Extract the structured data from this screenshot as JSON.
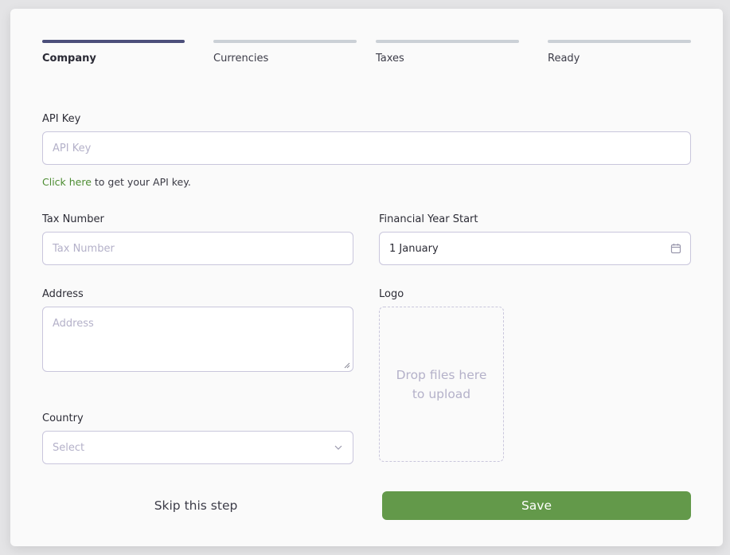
{
  "steps": [
    {
      "label": "Company",
      "active": true
    },
    {
      "label": "Currencies",
      "active": false
    },
    {
      "label": "Taxes",
      "active": false
    },
    {
      "label": "Ready",
      "active": false
    }
  ],
  "form": {
    "api_key": {
      "label": "API Key",
      "placeholder": "API Key"
    },
    "api_helper": {
      "link": "Click here",
      "text": " to get your API key."
    },
    "tax_number": {
      "label": "Tax Number",
      "placeholder": "Tax Number"
    },
    "financial_year": {
      "label": "Financial Year Start",
      "value": "1 January"
    },
    "address": {
      "label": "Address",
      "placeholder": "Address"
    },
    "logo": {
      "label": "Logo",
      "dropzone_text": "Drop files here to upload"
    },
    "country": {
      "label": "Country",
      "placeholder": "Select"
    }
  },
  "actions": {
    "skip_label": "Skip this step",
    "save_label": "Save"
  },
  "colors": {
    "accent": "#63994a",
    "active_step": "#4c4f7a",
    "link": "#4c8c31"
  }
}
